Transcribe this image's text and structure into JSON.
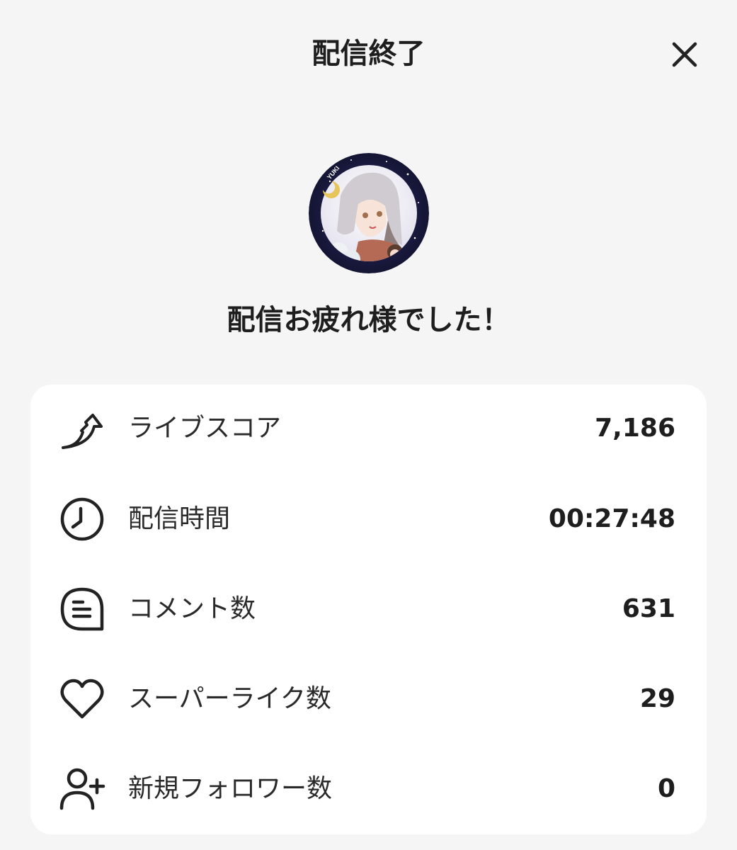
{
  "header": {
    "title": "配信終了",
    "close_icon": "close-icon"
  },
  "avatar": {
    "badge_text": "YUKI",
    "ring_color": "#1c1d4a"
  },
  "message": "配信お疲れ様でした！",
  "stats": [
    {
      "icon": "live-score-icon",
      "label": "ライブスコア",
      "value": "7,186"
    },
    {
      "icon": "clock-icon",
      "label": "配信時間",
      "value": "00:27:48"
    },
    {
      "icon": "comment-icon",
      "label": "コメント数",
      "value": "631"
    },
    {
      "icon": "heart-icon",
      "label": "スーパーライク数",
      "value": "29"
    },
    {
      "icon": "add-user-icon",
      "label": "新規フォロワー数",
      "value": "0"
    }
  ],
  "colors": {
    "background": "#f5f5f5",
    "card": "#ffffff",
    "text": "#1e1e1e"
  }
}
